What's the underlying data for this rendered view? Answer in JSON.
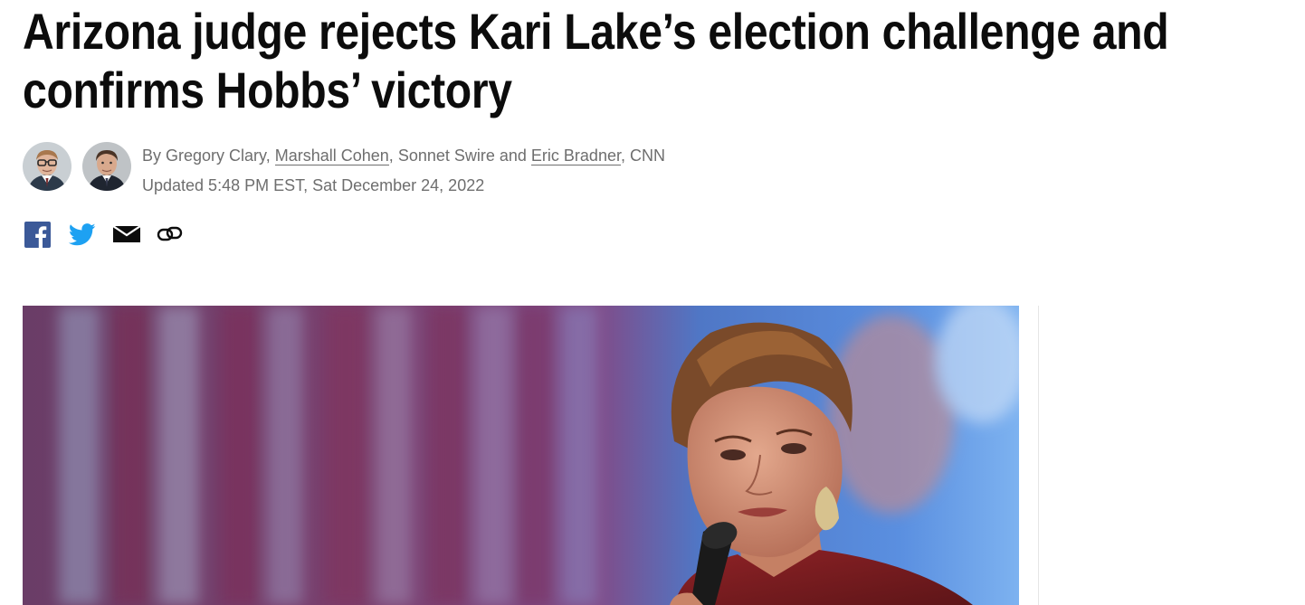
{
  "article": {
    "headline_line1": "Arizona judge rejects Kari Lake’s election challenge and",
    "headline_line2": "confirms Hobbs’ victory",
    "byline": {
      "prefix": "By ",
      "author1": "Gregory Clary",
      "sep1": ", ",
      "author2": "Marshall Cohen",
      "sep2": ", ",
      "author3": "Sonnet Swire",
      "sep3": " and ",
      "author4": "Eric Bradner",
      "suffix": ", CNN"
    },
    "timestamp": "Updated 5:48 PM EST, Sat December 24, 2022"
  },
  "share": {
    "icons": [
      "facebook-icon",
      "twitter-icon",
      "email-icon",
      "link-icon"
    ]
  },
  "colors": {
    "facebook": "#3b5998",
    "twitter": "#1da1f2",
    "meta_text": "#6e6e6e",
    "headline": "#0c0c0c"
  }
}
